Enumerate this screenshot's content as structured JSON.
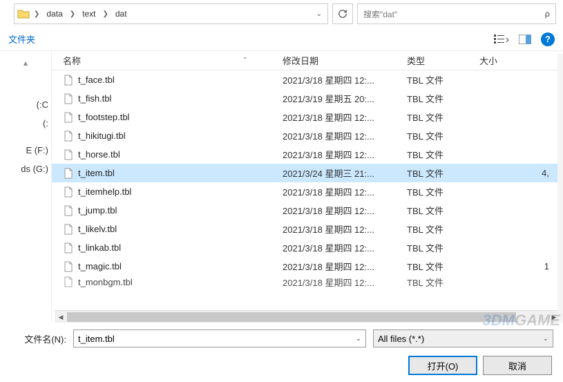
{
  "breadcrumb": {
    "parts": [
      "data",
      "text",
      "dat"
    ]
  },
  "search": {
    "placeholder": "搜索\"dat\""
  },
  "subbar": {
    "folder_label": "文件夹"
  },
  "sidebar": {
    "items": [
      "",
      "",
      "",
      "C:)",
      ":)",
      "",
      "E (F:)",
      "ds (G:)"
    ]
  },
  "headers": {
    "name": "名称",
    "date": "修改日期",
    "type": "类型",
    "size": "大小"
  },
  "files": [
    {
      "name": "t_face.tbl",
      "date": "2021/3/18 星期四 12:...",
      "type": "TBL 文件",
      "size": "",
      "selected": false
    },
    {
      "name": "t_fish.tbl",
      "date": "2021/3/19 星期五 20:...",
      "type": "TBL 文件",
      "size": "",
      "selected": false
    },
    {
      "name": "t_footstep.tbl",
      "date": "2021/3/18 星期四 12:...",
      "type": "TBL 文件",
      "size": "",
      "selected": false
    },
    {
      "name": "t_hikitugi.tbl",
      "date": "2021/3/18 星期四 12:...",
      "type": "TBL 文件",
      "size": "",
      "selected": false
    },
    {
      "name": "t_horse.tbl",
      "date": "2021/3/18 星期四 12:...",
      "type": "TBL 文件",
      "size": "",
      "selected": false
    },
    {
      "name": "t_item.tbl",
      "date": "2021/3/24 星期三 21:...",
      "type": "TBL 文件",
      "size": "4,",
      "selected": true
    },
    {
      "name": "t_itemhelp.tbl",
      "date": "2021/3/18 星期四 12:...",
      "type": "TBL 文件",
      "size": "",
      "selected": false
    },
    {
      "name": "t_jump.tbl",
      "date": "2021/3/18 星期四 12:...",
      "type": "TBL 文件",
      "size": "",
      "selected": false
    },
    {
      "name": "t_likelv.tbl",
      "date": "2021/3/18 星期四 12:...",
      "type": "TBL 文件",
      "size": "",
      "selected": false
    },
    {
      "name": "t_linkab.tbl",
      "date": "2021/3/18 星期四 12:...",
      "type": "TBL 文件",
      "size": "",
      "selected": false
    },
    {
      "name": "t_magic.tbl",
      "date": "2021/3/18 星期四 12:...",
      "type": "TBL 文件",
      "size": "1",
      "selected": false
    }
  ],
  "file_cutoff": {
    "name": "t_monbgm.tbl",
    "date": "2021/3/18 星期四 12:...",
    "type": "TBL 文件",
    "size": ""
  },
  "filename": {
    "label": "文件名(N):",
    "value": "t_item.tbl",
    "filter": "All files (*.*)"
  },
  "buttons": {
    "open": "打开(O)",
    "cancel": "取消"
  },
  "watermark": "3DMGAME"
}
